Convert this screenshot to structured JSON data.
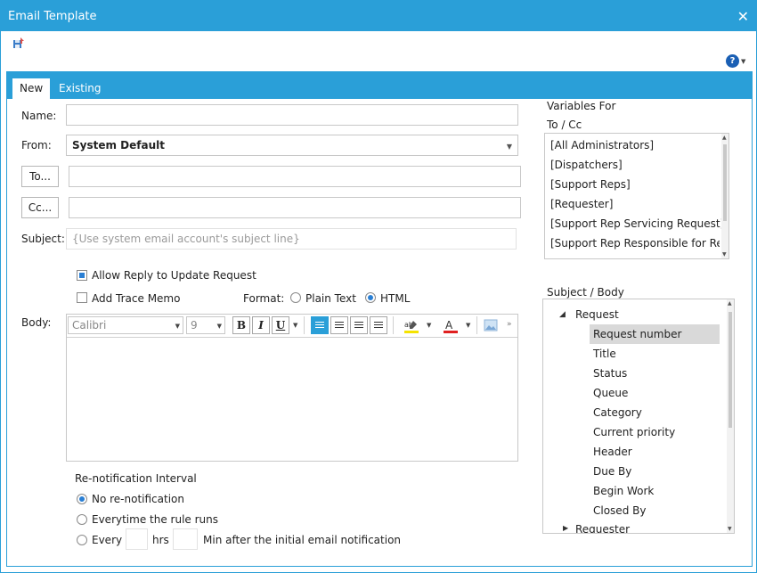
{
  "window": {
    "title": "Email Template"
  },
  "tabs": [
    {
      "label": "New"
    },
    {
      "label": "Existing"
    }
  ],
  "form": {
    "name_label": "Name:",
    "from_label": "From:",
    "from_value": "System Default",
    "to_button": "To...",
    "cc_button": "Cc...",
    "subject_label": "Subject:",
    "subject_placeholder": "{Use system email account's subject line}",
    "allow_reply_label": "Allow Reply to Update Request",
    "add_trace_label": "Add Trace Memo",
    "format_label": "Format:",
    "format_plain": "Plain Text",
    "format_html": "HTML",
    "body_label": "Body:",
    "font_value": "Calibri",
    "size_value": "9"
  },
  "renotify": {
    "title": "Re-notification Interval",
    "no_renotify": "No re-notification",
    "everytime": "Everytime the rule runs",
    "every": "Every",
    "hrs": "hrs",
    "min_after": "Min after the initial email notification"
  },
  "variables": {
    "title_line1": "Variables For",
    "title_line2": "To / Cc",
    "items": [
      "[All Administrators]",
      "[Dispatchers]",
      "[Support Reps]",
      "[Requester]",
      "[Support Rep Servicing Request]",
      "[Support Rep Responsible for Reque"
    ]
  },
  "subject_body": {
    "title": "Subject / Body",
    "root": "Request",
    "children": [
      "Request number",
      "Title",
      "Status",
      "Queue",
      "Category",
      "Current priority",
      "Header",
      "Due By",
      "Begin Work",
      "Closed By"
    ],
    "next_root": "Requester"
  },
  "colors": {
    "accent": "#2a9fd8",
    "selection": "#d9d9d9"
  }
}
